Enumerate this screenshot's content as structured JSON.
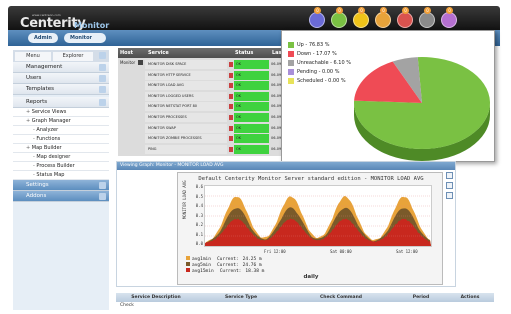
{
  "header": {
    "logo_small": "www.centreon.com",
    "logo_text": "Centerity",
    "logo_sub": "Monitor",
    "icons": [
      {
        "name": "home-icon",
        "color": "#6b6bd6"
      },
      {
        "name": "check-status-icon",
        "color": "#7ac143"
      },
      {
        "name": "warning-status-icon",
        "color": "#f0c419"
      },
      {
        "name": "unknown-status-icon",
        "color": "#e8a33a"
      },
      {
        "name": "critical-status-icon",
        "color": "#d9534f"
      },
      {
        "name": "pending-status-icon",
        "color": "#8a8a8a"
      },
      {
        "name": "unreachable-status-icon",
        "color": "#b56fd1"
      }
    ],
    "badges": [
      "0",
      "0",
      "0",
      "0",
      "0",
      "0",
      "0"
    ]
  },
  "topnav": {
    "admin_label": "Admin",
    "monitor_label": "Monitor"
  },
  "sidebar": {
    "tabs": [
      "Menu",
      "Explorer"
    ],
    "sections": [
      {
        "label": "Management",
        "type": "sec"
      },
      {
        "label": "Users",
        "type": "sec"
      },
      {
        "label": "Templates",
        "type": "sec"
      },
      {
        "label": "Reports",
        "type": "sec"
      },
      {
        "label": "Service Views",
        "type": "sub",
        "bullet": "+"
      },
      {
        "label": "Graph Manager",
        "type": "sub",
        "bullet": "+"
      },
      {
        "label": "Analyzer",
        "type": "sub2",
        "bullet": "-"
      },
      {
        "label": "Functions",
        "type": "sub2",
        "bullet": "-"
      },
      {
        "label": "Map Builder",
        "type": "sub",
        "bullet": "+"
      },
      {
        "label": "Map designer",
        "type": "sub2",
        "bullet": "-"
      },
      {
        "label": "Process Builder",
        "type": "sub2",
        "bullet": "-"
      },
      {
        "label": "Status Map",
        "type": "sub2",
        "bullet": "-"
      },
      {
        "label": "Settings",
        "type": "secblue"
      },
      {
        "label": "Addons",
        "type": "secblue"
      }
    ]
  },
  "service_table": {
    "headers": [
      "Host",
      "Service",
      "Status",
      "Las"
    ],
    "host": "Monitor",
    "rows": [
      {
        "service": "MONITOR DISK SPACE",
        "status": "OK",
        "last": "06-09"
      },
      {
        "service": "MONITOR HTTP SERVICE",
        "status": "OK",
        "last": "06-09"
      },
      {
        "service": "MONITOR LOAD AVG",
        "status": "OK",
        "last": "06-09"
      },
      {
        "service": "MONITOR LOGGED USERS",
        "status": "OK",
        "last": "06-09"
      },
      {
        "service": "MONITOR NETSTAT PORT 80",
        "status": "OK",
        "last": "06-09"
      },
      {
        "service": "MONITOR PROCESSES",
        "status": "OK",
        "last": "06-09"
      },
      {
        "service": "MONITOR SWAP",
        "status": "OK",
        "last": "06-09"
      },
      {
        "service": "MONITOR ZOMBIE PROCESSES",
        "status": "OK",
        "last": "06-09"
      },
      {
        "service": "PING",
        "status": "OK",
        "last": "06-09"
      }
    ]
  },
  "pie": {
    "legend": [
      {
        "label": "Up - 76.83 %",
        "color": "#7ac143",
        "value": 76.83
      },
      {
        "label": "Down - 17.07 %",
        "color": "#ef4b55",
        "value": 17.07
      },
      {
        "label": "Unreachable - 6.10 %",
        "color": "#a3a3a3",
        "value": 6.1
      },
      {
        "label": "Pending - 0.00 %",
        "color": "#a98fd8",
        "value": 0.0
      },
      {
        "label": "Scheduled - 0.00 %",
        "color": "#e8e35a",
        "value": 0.0
      }
    ]
  },
  "graph": {
    "title_bar": "Viewing Graph: Monitor - MONITOR LOAD AVG",
    "heading": "Default Centerity Monitor Server standard edition - MONITOR LOAD AVG",
    "ylabel": "MONITOR LOAD AVG",
    "yticks": [
      "0.6",
      "0.5",
      "0.4",
      "0.3",
      "0.2",
      "0.1",
      "0.0"
    ],
    "xticks": [
      "Fri 12:00",
      "Sat 00:00",
      "Sat 12:00"
    ],
    "legend": [
      {
        "label": "avg1min",
        "current": "Current:",
        "value": "24.25 m",
        "color": "#e8a33a"
      },
      {
        "label": "avg5min",
        "current": "Current:",
        "value": "24.76 m",
        "color": "#7a5a2a"
      },
      {
        "label": "avg15min",
        "current": "Current:",
        "value": "18.38 m",
        "color": "#c8281e"
      }
    ],
    "caption": "daily"
  },
  "bottom_table": {
    "headers": [
      "Service Description",
      "Service Type",
      "Check Command",
      "Period",
      "Actions"
    ],
    "first_cell": "Check"
  }
}
